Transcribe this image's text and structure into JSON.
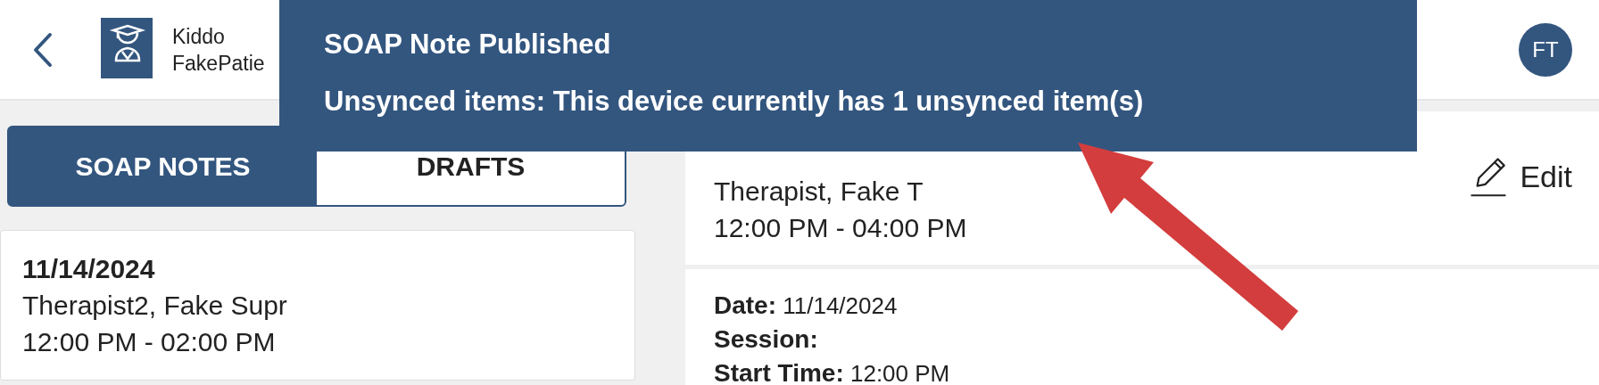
{
  "header": {
    "patient_first": "Kiddo",
    "patient_last": "FakePatie",
    "avatar_initials": "FT"
  },
  "toast": {
    "title": "SOAP Note Published",
    "message": "Unsynced items: This device currently has 1 unsynced item(s)"
  },
  "tabs": [
    {
      "label": "SOAP NOTES",
      "selected": true
    },
    {
      "label": "DRAFTS",
      "selected": false
    }
  ],
  "notes": [
    {
      "date": "11/14/2024",
      "therapist": "Therapist2, Fake Supr",
      "time": "12:00 PM - 02:00 PM"
    }
  ],
  "detail": {
    "therapist": "Therapist, Fake T",
    "time": "12:00 PM - 04:00 PM",
    "edit_label": "Edit",
    "fields": [
      {
        "label": "Date:",
        "value": "11/14/2024"
      },
      {
        "label": "Session:"
      },
      {
        "label": "Start Time:",
        "value": "12:00 PM"
      }
    ]
  }
}
